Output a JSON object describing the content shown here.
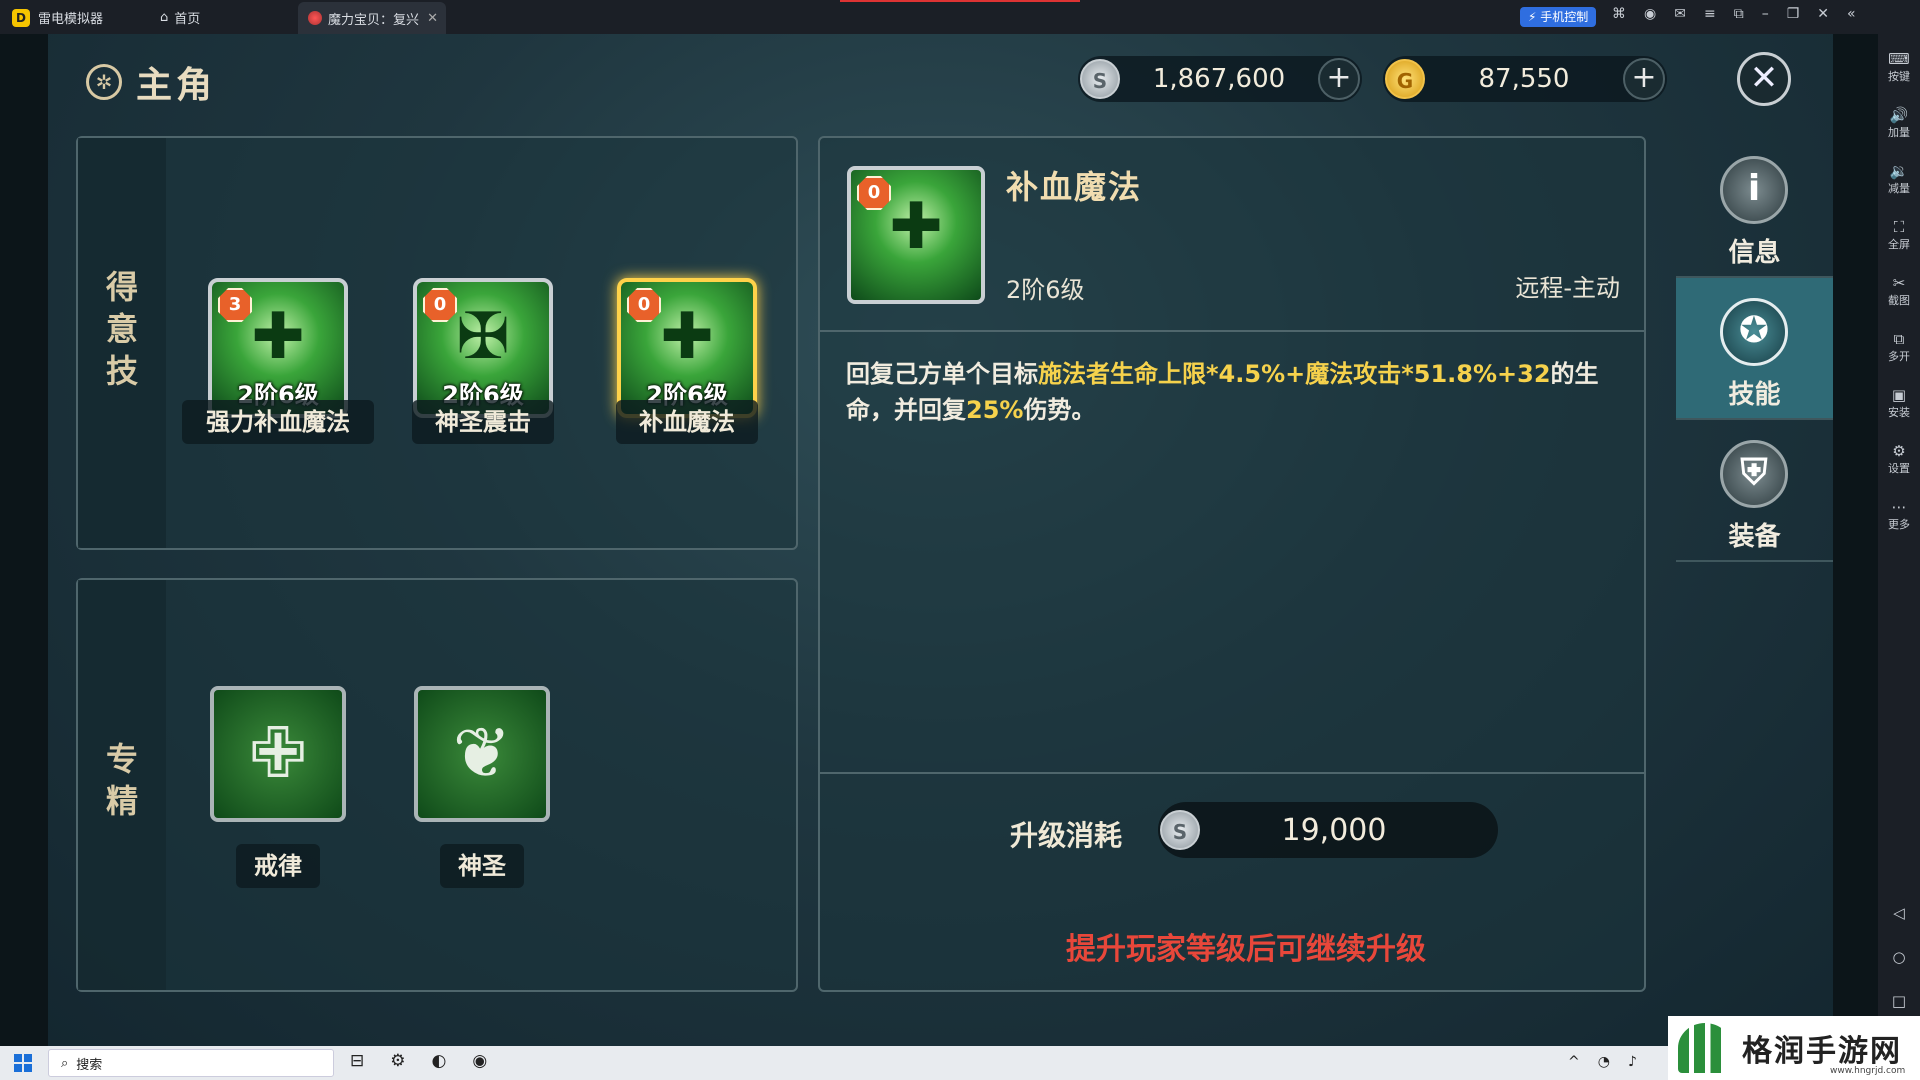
{
  "emulator": {
    "app_name": "雷电模拟器",
    "home_tab": "首页",
    "game_tab": "魔力宝贝：复兴",
    "phone_control": "手机控制",
    "side_tools": [
      "按键",
      "加量",
      "减量",
      "全屏",
      "截图",
      "多开",
      "安装",
      "设置",
      "更多"
    ]
  },
  "header": {
    "title": "主角",
    "silver_amount": "1,867,600",
    "gold_amount": "87,550"
  },
  "favorite_skills": {
    "section_label": "得意技",
    "items": [
      {
        "name": "强力补血魔法",
        "level": "2阶6级",
        "badge": "3",
        "selected": false
      },
      {
        "name": "神圣震击",
        "level": "2阶6级",
        "badge": "0",
        "selected": false
      },
      {
        "name": "补血魔法",
        "level": "2阶6级",
        "badge": "0",
        "selected": true
      }
    ]
  },
  "specialties": {
    "section_label": "专精",
    "items": [
      {
        "name": "戒律"
      },
      {
        "name": "神圣"
      }
    ]
  },
  "detail": {
    "badge": "0",
    "name": "补血魔法",
    "level": "2阶6级",
    "type": "远程-主动",
    "desc_part1": "回复己方单个目标",
    "desc_hl1": "施法者生命上限*4.5%+魔法攻击*51.8%+32",
    "desc_part2": "的生命，并回复",
    "desc_hl2": "25%",
    "desc_part3": "伤势。",
    "cost_label": "升级消耗",
    "cost_amount": "19,000",
    "warning": "提升玩家等级后可继续升级"
  },
  "side_tabs": [
    {
      "label": "信息",
      "active": false
    },
    {
      "label": "技能",
      "active": true
    },
    {
      "label": "装备",
      "active": false
    }
  ],
  "taskbar": {
    "search_placeholder": "搜索"
  },
  "watermark": {
    "text": "格润手游网",
    "url": "www.hngrjd.com"
  },
  "colors": {
    "highlight": "#f6d24c",
    "warning": "#e8473a",
    "active_tab": "#2f6a76"
  }
}
